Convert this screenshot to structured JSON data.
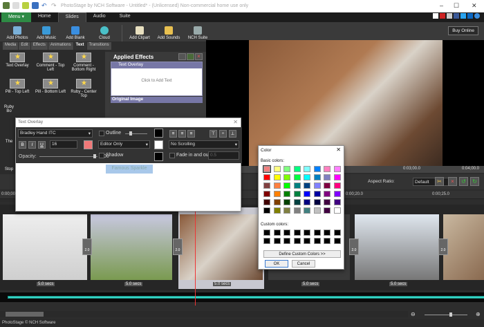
{
  "window": {
    "title": "PhotoStage by NCH Software - Untitled* - (Unlicensed) Non-commercial home use only",
    "minimize": "–",
    "maximize": "☐",
    "close": "✕"
  },
  "tabs": [
    {
      "label": "Menu ▾"
    },
    {
      "label": "Home"
    },
    {
      "label": "Slides"
    },
    {
      "label": "Audio"
    },
    {
      "label": "Suite"
    }
  ],
  "ribbon": [
    {
      "label": "Add Photos",
      "icon": "photos-icon",
      "color": "#7ab0d8"
    },
    {
      "label": "Add Music",
      "icon": "music-icon",
      "color": "#3a9ad8"
    },
    {
      "label": "Add Blank",
      "icon": "blank-icon",
      "color": "#3a8ee0"
    },
    {
      "label": "Cloud",
      "icon": "cloud-icon",
      "color": "#4ac0c8"
    },
    {
      "label": "Add Clipart",
      "icon": "clipart-icon",
      "color": "#e8e0c0"
    },
    {
      "label": "Add Sounds",
      "icon": "sounds-icon",
      "color": "#e8c050"
    },
    {
      "label": "NCH Suite",
      "icon": "suite-icon",
      "color": "#9aa"
    }
  ],
  "buy_online": "Buy Online",
  "subtabs": [
    "Media",
    "Edit",
    "Effects",
    "Animations",
    "Text",
    "Transitions"
  ],
  "effects": [
    "Text Overlay",
    "Comment - Top Left",
    "Comment - Bottom Right",
    "Pill - Top Left",
    "Pill - Bottom Left",
    "Ruby - Center Top",
    "Ruby Bo",
    "",
    "",
    "The",
    "Stop",
    ""
  ],
  "applied": {
    "title": "Applied Effects",
    "overlay_title": "Text Overlay",
    "overlay_body": "Click to Add Text",
    "original": "Original Image"
  },
  "timeline": {
    "ruler1": [
      "0:03;00.0",
      "0:04;00.0"
    ],
    "ruler2": [
      "0:00;20.0",
      "0:00;25.0"
    ],
    "ruler_left": "0:00;00",
    "aspect_label": "Aspect Ratio:",
    "aspect_value": "Default",
    "clip_labels": [
      "5.0 secs",
      "5.0 secs",
      "5.0 secs",
      "5.0 secs",
      "5.0 secs"
    ],
    "transition_value": "2.0"
  },
  "status": "PhotoStage © NCH Software",
  "text_dialog": {
    "title": "Text Overlay",
    "font": "Bradley Hand ITC",
    "size": "16",
    "bold": "B",
    "italic": "I",
    "underline": "U",
    "outline": "Outline",
    "mode": "Editor Only",
    "shadow": "Shadow",
    "opacity_label": "Opacity:",
    "opacity": "100",
    "opacity_value": 100,
    "scrolling": "No Scrolling",
    "fade": "Fade in and out",
    "fade_value": "0.5",
    "selected_text": "Famous Sparkle",
    "text_color": "#f07878"
  },
  "color_dialog": {
    "title": "Color",
    "close": "✕",
    "basic_label": "Basic colors:",
    "custom_label": "Custom colors:",
    "define": "Define Custom Colors >>",
    "ok": "OK",
    "cancel": "Cancel",
    "basic_colors": [
      "#f08080",
      "#ffff80",
      "#80ff80",
      "#00ff80",
      "#80ffff",
      "#0080ff",
      "#ff80c0",
      "#ff80ff",
      "#ff0000",
      "#ffff00",
      "#80ff00",
      "#00ff40",
      "#00ffff",
      "#0080c0",
      "#8080c0",
      "#ff00ff",
      "#804040",
      "#ff8040",
      "#00ff00",
      "#008080",
      "#004080",
      "#8080ff",
      "#800040",
      "#ff0080",
      "#800000",
      "#ff8000",
      "#008000",
      "#008040",
      "#0000ff",
      "#0000a0",
      "#800080",
      "#8000ff",
      "#400000",
      "#804000",
      "#004000",
      "#004040",
      "#000080",
      "#000040",
      "#400040",
      "#400080",
      "#000000",
      "#808000",
      "#808040",
      "#808080",
      "#408080",
      "#c0c0c0",
      "#400040",
      "#ffffff"
    ]
  }
}
